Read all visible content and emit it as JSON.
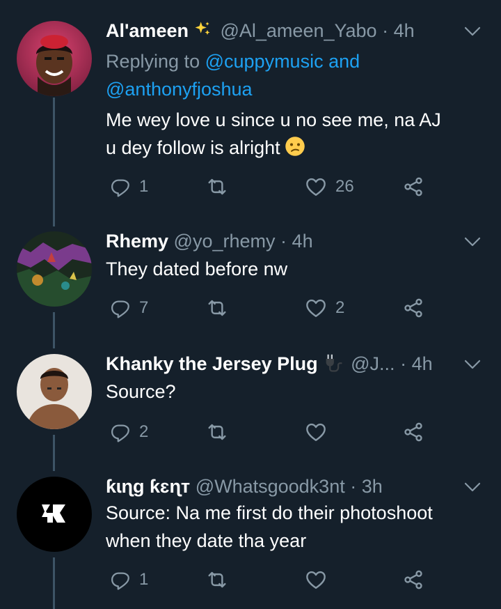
{
  "tweets": [
    {
      "name": "Al'ameen",
      "name_emoji": "sparkles-icon",
      "handle": "@Al_ameen_Yabo",
      "dot": "·",
      "time": "4h",
      "replying_label": "Replying to",
      "mention_1": "@cuppymusic",
      "mention_and": "and",
      "mention_2": "@anthonyfjoshua",
      "text_line_1": "Me wey love u since u no see me, na AJ",
      "text_line_2": "u dey follow is alright",
      "text_emoji": "confused-face-icon",
      "replies": "1",
      "retweets": "",
      "likes": "26"
    },
    {
      "name": "Rhemy",
      "handle": "@yo_rhemy",
      "dot": "·",
      "time": "4h",
      "text_line_1": "They dated before nw",
      "replies": "7",
      "retweets": "",
      "likes": "2"
    },
    {
      "name": "Khanky the Jersey Plug",
      "name_emoji": "electric-plug-icon",
      "handle": "@J...",
      "dot": "·",
      "time": "4h",
      "text_line_1": "Source?",
      "replies": "2",
      "retweets": "",
      "likes": ""
    },
    {
      "name": "ƙɩɳg ƙɛɳт",
      "handle": "@Whatsgoodk3nt",
      "dot": "·",
      "time": "3h",
      "text_line_1": "Source: Na me first do their photoshoot",
      "text_line_2": "when they date tha year",
      "replies": "1",
      "retweets": "",
      "likes": ""
    }
  ],
  "colors": {
    "background": "#15202b",
    "secondary_text": "#8899a6",
    "link": "#1da1f2",
    "thread_line": "#3d5466"
  }
}
